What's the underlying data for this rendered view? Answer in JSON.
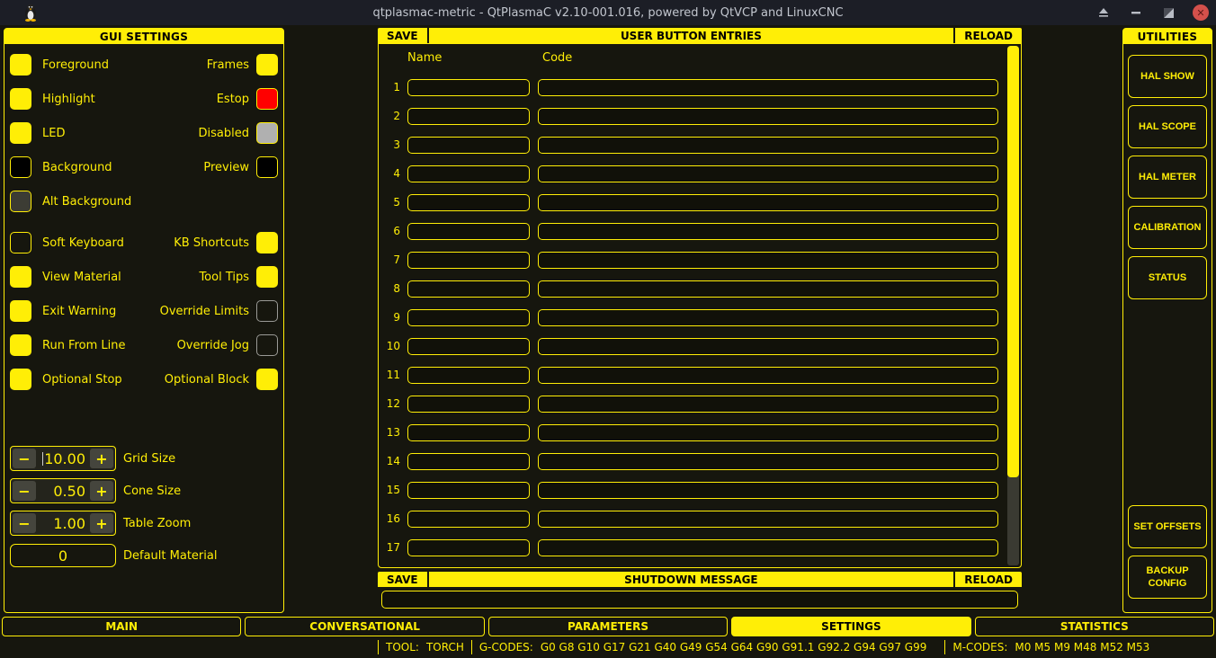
{
  "titlebar": {
    "title": "qtplasmac-metric - QtPlasmaC v2.10-001.016, powered by QtVCP and LinuxCNC",
    "app_icon": "linux-penguin-icon",
    "control_icons": [
      "shade-icon",
      "minimize-icon",
      "maximize-icon",
      "close-icon"
    ]
  },
  "colors": {
    "accent_yellow": "#ffee06",
    "estop_red": "#ff0000",
    "disabled_gray": "#b0b0b0",
    "background_black": "#000000",
    "alt_background_gray": "#3c3c34",
    "panel_bg": "#16160e"
  },
  "gui_settings": {
    "header": "GUI SETTINGS",
    "swatch_rows": [
      {
        "left": {
          "label": "Foreground",
          "color": "#ffee06"
        },
        "right": {
          "label": "Frames",
          "color": "#ffee06"
        }
      },
      {
        "left": {
          "label": "Highlight",
          "color": "#ffee06"
        },
        "right": {
          "label": "Estop",
          "color": "#ff0000"
        }
      },
      {
        "left": {
          "label": "LED",
          "color": "#ffee06"
        },
        "right": {
          "label": "Disabled",
          "color": "#b0b0b0"
        }
      },
      {
        "left": {
          "label": "Background",
          "color": "#000000"
        },
        "right": {
          "label": "Preview",
          "color": "#000000"
        }
      },
      {
        "left": {
          "label": "Alt Background",
          "color": "#3c3c34"
        },
        "right": null
      }
    ],
    "checkbox_rows": [
      {
        "left": {
          "label": "Soft Keyboard",
          "checked": false,
          "enabled": true
        },
        "right": {
          "label": "KB Shortcuts",
          "checked": true,
          "enabled": true
        }
      },
      {
        "left": {
          "label": "View Material",
          "checked": true,
          "enabled": true
        },
        "right": {
          "label": "Tool Tips",
          "checked": true,
          "enabled": true
        }
      },
      {
        "left": {
          "label": "Exit Warning",
          "checked": true,
          "enabled": true
        },
        "right": {
          "label": "Override Limits",
          "checked": false,
          "enabled": false
        }
      },
      {
        "left": {
          "label": "Run From Line",
          "checked": true,
          "enabled": true
        },
        "right": {
          "label": "Override Jog",
          "checked": false,
          "enabled": false
        }
      },
      {
        "left": {
          "label": "Optional Stop",
          "checked": true,
          "enabled": true
        },
        "right": {
          "label": "Optional Block",
          "checked": true,
          "enabled": true
        }
      }
    ],
    "fields": [
      {
        "type": "spin",
        "value": "10.00",
        "label": "Grid Size",
        "caret": true
      },
      {
        "type": "spin",
        "value": "0.50",
        "label": "Cone Size",
        "caret": false
      },
      {
        "type": "spin",
        "value": "1.00",
        "label": "Table Zoom",
        "caret": false
      },
      {
        "type": "plain",
        "value": "0",
        "label": "Default Material",
        "caret": false
      }
    ],
    "spin_minus_label": "−",
    "spin_plus_label": "+"
  },
  "user_buttons": {
    "save_label": "SAVE",
    "title": "USER BUTTON ENTRIES",
    "reload_label": "RELOAD",
    "name_header": "Name",
    "code_header": "Code",
    "rows": [
      {
        "num": "1",
        "name": "",
        "code": ""
      },
      {
        "num": "2",
        "name": "",
        "code": ""
      },
      {
        "num": "3",
        "name": "",
        "code": ""
      },
      {
        "num": "4",
        "name": "",
        "code": ""
      },
      {
        "num": "5",
        "name": "",
        "code": ""
      },
      {
        "num": "6",
        "name": "",
        "code": ""
      },
      {
        "num": "7",
        "name": "",
        "code": ""
      },
      {
        "num": "8",
        "name": "",
        "code": ""
      },
      {
        "num": "9",
        "name": "",
        "code": ""
      },
      {
        "num": "10",
        "name": "",
        "code": ""
      },
      {
        "num": "11",
        "name": "",
        "code": ""
      },
      {
        "num": "12",
        "name": "",
        "code": ""
      },
      {
        "num": "13",
        "name": "",
        "code": ""
      },
      {
        "num": "14",
        "name": "",
        "code": ""
      },
      {
        "num": "15",
        "name": "",
        "code": ""
      },
      {
        "num": "16",
        "name": "",
        "code": ""
      },
      {
        "num": "17",
        "name": "",
        "code": ""
      }
    ]
  },
  "shutdown": {
    "save_label": "SAVE",
    "title": "SHUTDOWN MESSAGE",
    "reload_label": "RELOAD",
    "message": ""
  },
  "utilities": {
    "header": "UTILITIES",
    "buttons": [
      "HAL SHOW",
      "HAL SCOPE",
      "HAL METER",
      "CALIBRATION",
      "STATUS"
    ],
    "bottom_buttons": [
      "SET OFFSETS",
      "BACKUP CONFIG"
    ]
  },
  "tabs": [
    {
      "label": "MAIN",
      "active": false
    },
    {
      "label": "CONVERSATIONAL",
      "active": false
    },
    {
      "label": "PARAMETERS",
      "active": false
    },
    {
      "label": "SETTINGS",
      "active": true
    },
    {
      "label": "STATISTICS",
      "active": false
    }
  ],
  "statusbar": {
    "tool_label": "TOOL:",
    "tool_value": "TORCH",
    "gcodes_label": "G-CODES:",
    "gcodes_value": "G0 G8 G10 G17 G21 G40 G49 G54 G64 G90 G91.1 G92.2 G94 G97 G99",
    "mcodes_label": "M-CODES:",
    "mcodes_value": "M0 M5 M9 M48 M52 M53"
  }
}
